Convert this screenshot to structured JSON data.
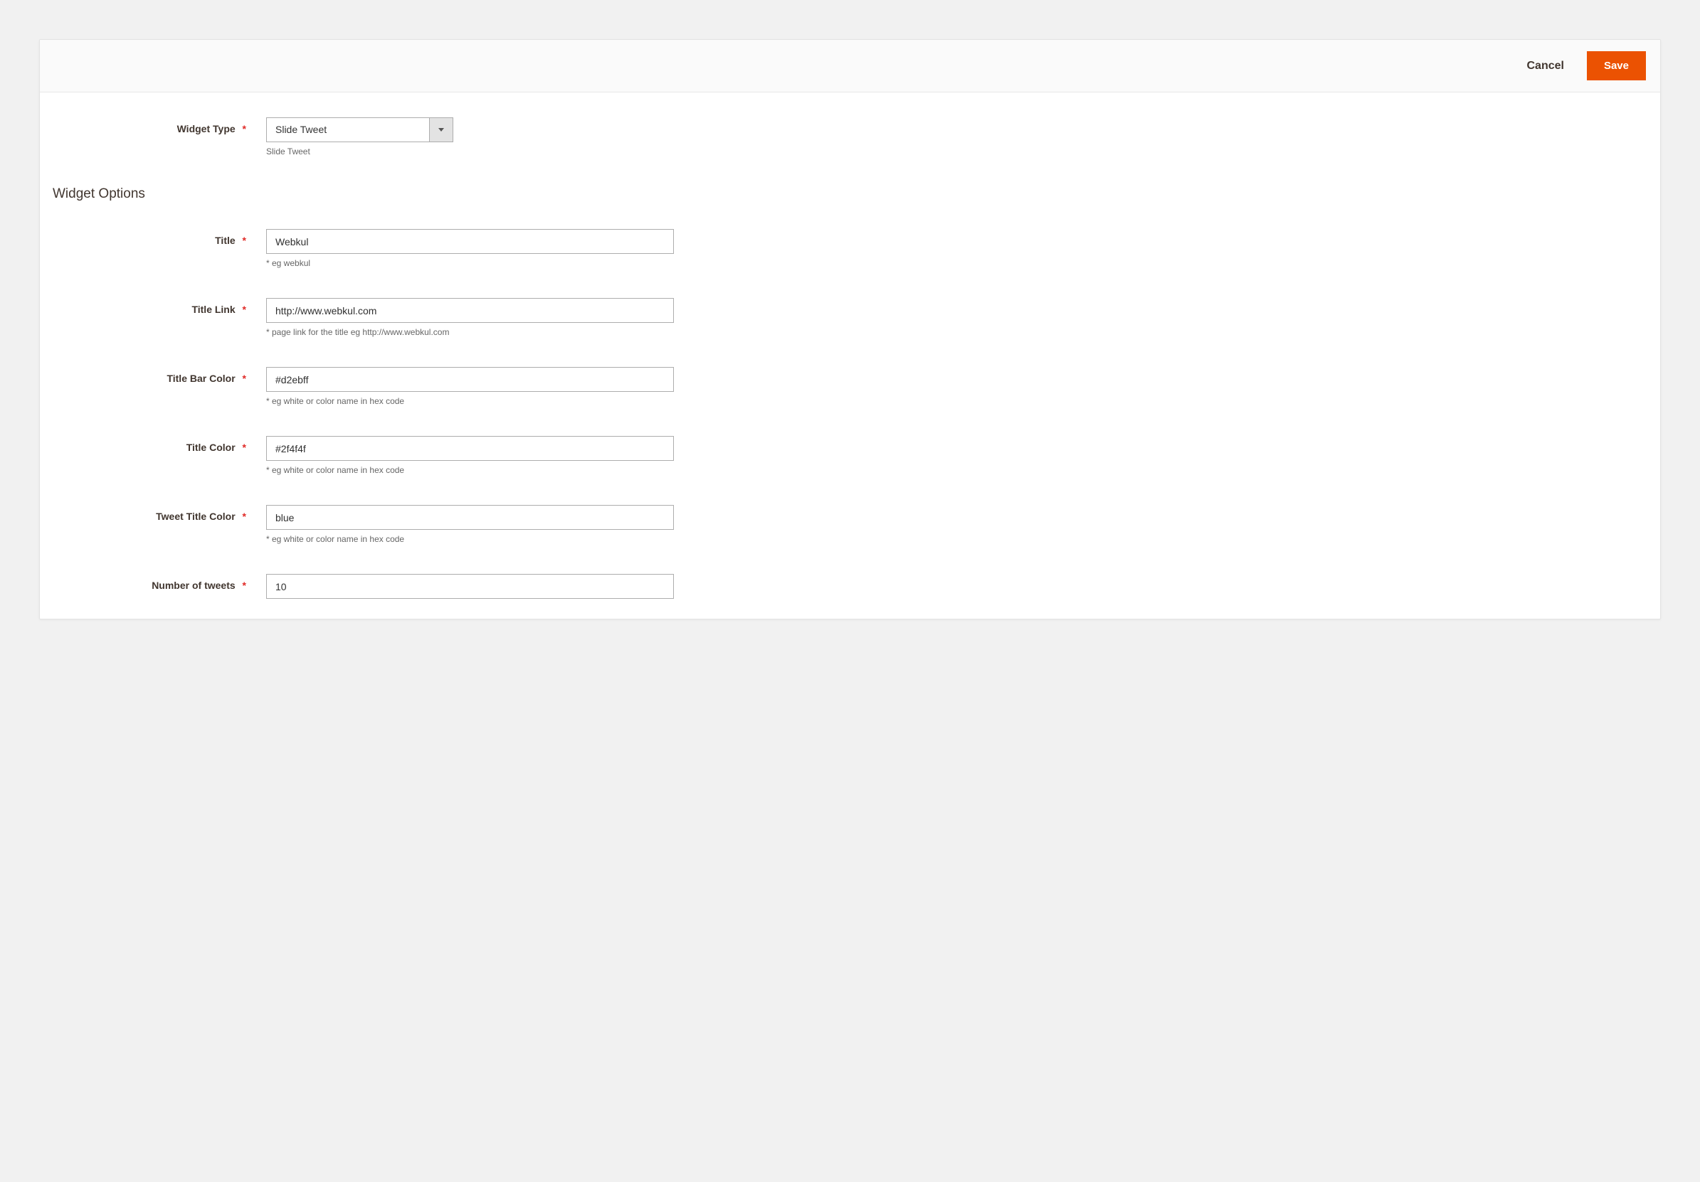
{
  "header": {
    "cancel_label": "Cancel",
    "save_label": "Save"
  },
  "widget_type": {
    "label": "Widget Type",
    "value": "Slide Tweet",
    "hint": "Slide Tweet"
  },
  "section_title": "Widget Options",
  "fields": {
    "title": {
      "label": "Title",
      "value": "Webkul",
      "hint": "* eg webkul"
    },
    "title_link": {
      "label": "Title Link",
      "value": "http://www.webkul.com",
      "hint": "* page link for the title eg http://www.webkul.com"
    },
    "title_bar_color": {
      "label": "Title Bar Color",
      "value": "#d2ebff",
      "hint": "* eg white or color name in hex code"
    },
    "title_color": {
      "label": "Title Color",
      "value": "#2f4f4f",
      "hint": "* eg white or color name in hex code"
    },
    "tweet_title_color": {
      "label": "Tweet Title Color",
      "value": "blue",
      "hint": "* eg white or color name in hex code"
    },
    "number_of_tweets": {
      "label": "Number of tweets",
      "value": "10"
    }
  },
  "required_mark": "*"
}
